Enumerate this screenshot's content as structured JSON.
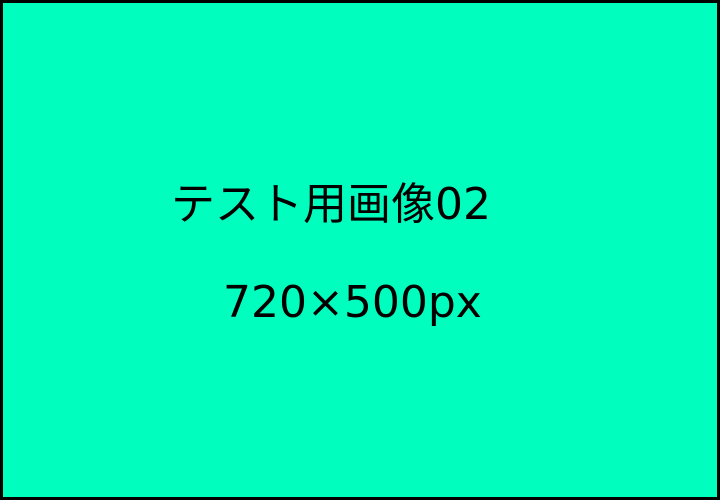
{
  "image": {
    "background_color": "#00FFBF",
    "border_color": "#000000",
    "text_color": "#000000",
    "line1": "テスト用画像02",
    "line2": "720×500px"
  }
}
